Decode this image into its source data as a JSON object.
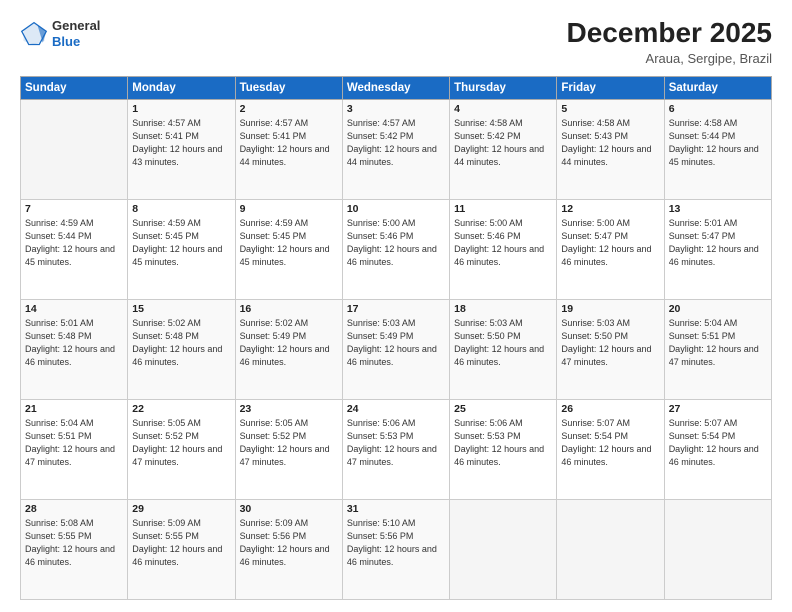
{
  "header": {
    "logo_general": "General",
    "logo_blue": "Blue",
    "month_title": "December 2025",
    "location": "Araua, Sergipe, Brazil"
  },
  "days_of_week": [
    "Sunday",
    "Monday",
    "Tuesday",
    "Wednesday",
    "Thursday",
    "Friday",
    "Saturday"
  ],
  "weeks": [
    [
      {
        "day": "",
        "sunrise": "",
        "sunset": "",
        "daylight": ""
      },
      {
        "day": "1",
        "sunrise": "Sunrise: 4:57 AM",
        "sunset": "Sunset: 5:41 PM",
        "daylight": "Daylight: 12 hours and 43 minutes."
      },
      {
        "day": "2",
        "sunrise": "Sunrise: 4:57 AM",
        "sunset": "Sunset: 5:41 PM",
        "daylight": "Daylight: 12 hours and 44 minutes."
      },
      {
        "day": "3",
        "sunrise": "Sunrise: 4:57 AM",
        "sunset": "Sunset: 5:42 PM",
        "daylight": "Daylight: 12 hours and 44 minutes."
      },
      {
        "day": "4",
        "sunrise": "Sunrise: 4:58 AM",
        "sunset": "Sunset: 5:42 PM",
        "daylight": "Daylight: 12 hours and 44 minutes."
      },
      {
        "day": "5",
        "sunrise": "Sunrise: 4:58 AM",
        "sunset": "Sunset: 5:43 PM",
        "daylight": "Daylight: 12 hours and 44 minutes."
      },
      {
        "day": "6",
        "sunrise": "Sunrise: 4:58 AM",
        "sunset": "Sunset: 5:44 PM",
        "daylight": "Daylight: 12 hours and 45 minutes."
      }
    ],
    [
      {
        "day": "7",
        "sunrise": "Sunrise: 4:59 AM",
        "sunset": "Sunset: 5:44 PM",
        "daylight": "Daylight: 12 hours and 45 minutes."
      },
      {
        "day": "8",
        "sunrise": "Sunrise: 4:59 AM",
        "sunset": "Sunset: 5:45 PM",
        "daylight": "Daylight: 12 hours and 45 minutes."
      },
      {
        "day": "9",
        "sunrise": "Sunrise: 4:59 AM",
        "sunset": "Sunset: 5:45 PM",
        "daylight": "Daylight: 12 hours and 45 minutes."
      },
      {
        "day": "10",
        "sunrise": "Sunrise: 5:00 AM",
        "sunset": "Sunset: 5:46 PM",
        "daylight": "Daylight: 12 hours and 46 minutes."
      },
      {
        "day": "11",
        "sunrise": "Sunrise: 5:00 AM",
        "sunset": "Sunset: 5:46 PM",
        "daylight": "Daylight: 12 hours and 46 minutes."
      },
      {
        "day": "12",
        "sunrise": "Sunrise: 5:00 AM",
        "sunset": "Sunset: 5:47 PM",
        "daylight": "Daylight: 12 hours and 46 minutes."
      },
      {
        "day": "13",
        "sunrise": "Sunrise: 5:01 AM",
        "sunset": "Sunset: 5:47 PM",
        "daylight": "Daylight: 12 hours and 46 minutes."
      }
    ],
    [
      {
        "day": "14",
        "sunrise": "Sunrise: 5:01 AM",
        "sunset": "Sunset: 5:48 PM",
        "daylight": "Daylight: 12 hours and 46 minutes."
      },
      {
        "day": "15",
        "sunrise": "Sunrise: 5:02 AM",
        "sunset": "Sunset: 5:48 PM",
        "daylight": "Daylight: 12 hours and 46 minutes."
      },
      {
        "day": "16",
        "sunrise": "Sunrise: 5:02 AM",
        "sunset": "Sunset: 5:49 PM",
        "daylight": "Daylight: 12 hours and 46 minutes."
      },
      {
        "day": "17",
        "sunrise": "Sunrise: 5:03 AM",
        "sunset": "Sunset: 5:49 PM",
        "daylight": "Daylight: 12 hours and 46 minutes."
      },
      {
        "day": "18",
        "sunrise": "Sunrise: 5:03 AM",
        "sunset": "Sunset: 5:50 PM",
        "daylight": "Daylight: 12 hours and 46 minutes."
      },
      {
        "day": "19",
        "sunrise": "Sunrise: 5:03 AM",
        "sunset": "Sunset: 5:50 PM",
        "daylight": "Daylight: 12 hours and 47 minutes."
      },
      {
        "day": "20",
        "sunrise": "Sunrise: 5:04 AM",
        "sunset": "Sunset: 5:51 PM",
        "daylight": "Daylight: 12 hours and 47 minutes."
      }
    ],
    [
      {
        "day": "21",
        "sunrise": "Sunrise: 5:04 AM",
        "sunset": "Sunset: 5:51 PM",
        "daylight": "Daylight: 12 hours and 47 minutes."
      },
      {
        "day": "22",
        "sunrise": "Sunrise: 5:05 AM",
        "sunset": "Sunset: 5:52 PM",
        "daylight": "Daylight: 12 hours and 47 minutes."
      },
      {
        "day": "23",
        "sunrise": "Sunrise: 5:05 AM",
        "sunset": "Sunset: 5:52 PM",
        "daylight": "Daylight: 12 hours and 47 minutes."
      },
      {
        "day": "24",
        "sunrise": "Sunrise: 5:06 AM",
        "sunset": "Sunset: 5:53 PM",
        "daylight": "Daylight: 12 hours and 47 minutes."
      },
      {
        "day": "25",
        "sunrise": "Sunrise: 5:06 AM",
        "sunset": "Sunset: 5:53 PM",
        "daylight": "Daylight: 12 hours and 46 minutes."
      },
      {
        "day": "26",
        "sunrise": "Sunrise: 5:07 AM",
        "sunset": "Sunset: 5:54 PM",
        "daylight": "Daylight: 12 hours and 46 minutes."
      },
      {
        "day": "27",
        "sunrise": "Sunrise: 5:07 AM",
        "sunset": "Sunset: 5:54 PM",
        "daylight": "Daylight: 12 hours and 46 minutes."
      }
    ],
    [
      {
        "day": "28",
        "sunrise": "Sunrise: 5:08 AM",
        "sunset": "Sunset: 5:55 PM",
        "daylight": "Daylight: 12 hours and 46 minutes."
      },
      {
        "day": "29",
        "sunrise": "Sunrise: 5:09 AM",
        "sunset": "Sunset: 5:55 PM",
        "daylight": "Daylight: 12 hours and 46 minutes."
      },
      {
        "day": "30",
        "sunrise": "Sunrise: 5:09 AM",
        "sunset": "Sunset: 5:56 PM",
        "daylight": "Daylight: 12 hours and 46 minutes."
      },
      {
        "day": "31",
        "sunrise": "Sunrise: 5:10 AM",
        "sunset": "Sunset: 5:56 PM",
        "daylight": "Daylight: 12 hours and 46 minutes."
      },
      {
        "day": "",
        "sunrise": "",
        "sunset": "",
        "daylight": ""
      },
      {
        "day": "",
        "sunrise": "",
        "sunset": "",
        "daylight": ""
      },
      {
        "day": "",
        "sunrise": "",
        "sunset": "",
        "daylight": ""
      }
    ]
  ]
}
